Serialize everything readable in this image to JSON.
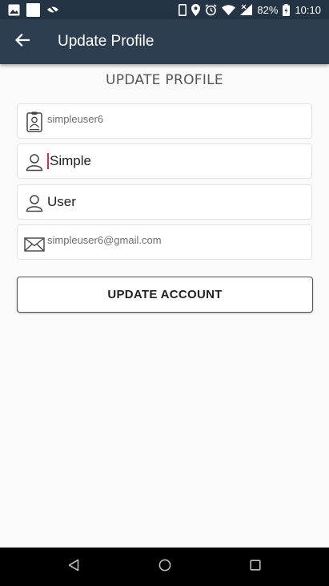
{
  "status_bar": {
    "battery": "82%",
    "time": "10:10",
    "icons": [
      "image-icon",
      "square-notification-icon",
      "eye-off-icon",
      "phone-icon",
      "location-icon",
      "alarm-icon",
      "wifi-icon",
      "signal-icon",
      "battery-icon"
    ]
  },
  "app_bar": {
    "title": "Update Profile",
    "back_icon": "arrow-back-icon"
  },
  "form": {
    "heading": "UPDATE PROFILE",
    "username": {
      "value": "simpleuser6",
      "icon": "user-id-icon"
    },
    "first_name": {
      "value": "Simple",
      "icon": "person-icon"
    },
    "last_name": {
      "value": "User",
      "icon": "person-icon"
    },
    "email": {
      "value": "simpleuser6@gmail.com",
      "icon": "envelope-icon"
    },
    "submit_label": "UPDATE ACCOUNT"
  },
  "nav_bar": {
    "icons": [
      "back-triangle-icon",
      "home-circle-icon",
      "recents-square-icon"
    ]
  },
  "colors": {
    "status_bar": "#243444",
    "app_bar": "#2c3e50",
    "cursor": "#e0245e"
  }
}
